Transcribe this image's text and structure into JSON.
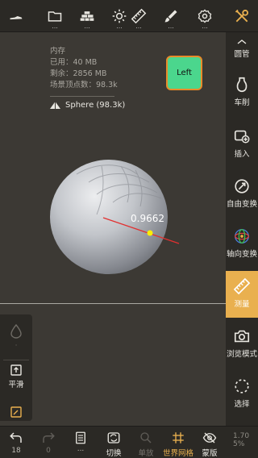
{
  "stats": {
    "memory_label": "内存",
    "used": "已用：40 MB",
    "remaining": "剩余：2856 MB",
    "scene_vertices": "场景顶点数：98.3k"
  },
  "mesh": {
    "name": "Sphere (98.3k)"
  },
  "viewcube": {
    "label": "Left"
  },
  "measure": {
    "value": "0.9662"
  },
  "topbar": {
    "menu_dots": "..."
  },
  "sidebar": {
    "items": [
      {
        "label": "圆管"
      },
      {
        "label": "车削"
      },
      {
        "label": "插入"
      },
      {
        "label": "自由变换"
      },
      {
        "label": "轴向变换"
      },
      {
        "label": "测量"
      },
      {
        "label": "浏览模式"
      },
      {
        "label": "选择"
      }
    ]
  },
  "leftpanel": {
    "dot": "·",
    "smooth_label": "平滑"
  },
  "bottombar": {
    "undo_count": "18",
    "redo_count": "0",
    "switch_label": "切换",
    "single_label": "单放",
    "world_grid_label": "世界网格",
    "mask_label": "蒙版",
    "zoom_top": "1.70",
    "zoom_bottom": "5%"
  },
  "colors": {
    "accent": "#e9b04f",
    "background": "#3c3934",
    "panel": "#2b2925",
    "viewcube_fill": "#4bd68d",
    "viewcube_border": "#e98b2a",
    "measure_line": "#e23030",
    "measure_point": "#ffee00"
  }
}
